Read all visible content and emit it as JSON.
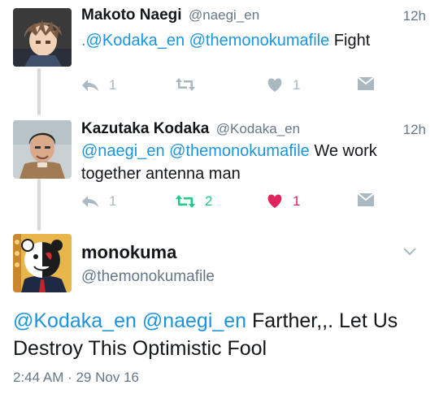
{
  "tweets": [
    {
      "name": "Makoto Naegi",
      "handle": "@naegi_en",
      "time": "12h",
      "text_mentions": ".@Kodaka_en @themonokumafile",
      "text_body": " Fight",
      "reply_count": "1",
      "retweet_count": "",
      "like_count": "1"
    },
    {
      "name": "Kazutaka Kodaka",
      "handle": "@Kodaka_en",
      "time": "12h",
      "text_mentions": "@naegi_en @themonokumafile",
      "text_body": " We work",
      "text_line2": "together antenna man",
      "reply_count": "1",
      "retweet_count": "2",
      "like_count": "1"
    }
  ],
  "focus": {
    "name": "monokuma",
    "handle": "@themonokumafile",
    "text_mentions": "@Kodaka_en @naegi_en",
    "text_body": " Farther,,. Let Us",
    "text_line2": "Destroy This Optimistic Fool",
    "timestamp": "2:44 AM · 29 Nov 16"
  },
  "colors": {
    "link": "#1b95e0",
    "retweet_active": "#19cf86",
    "like_active": "#e0245e",
    "muted": "#aab8c2"
  }
}
